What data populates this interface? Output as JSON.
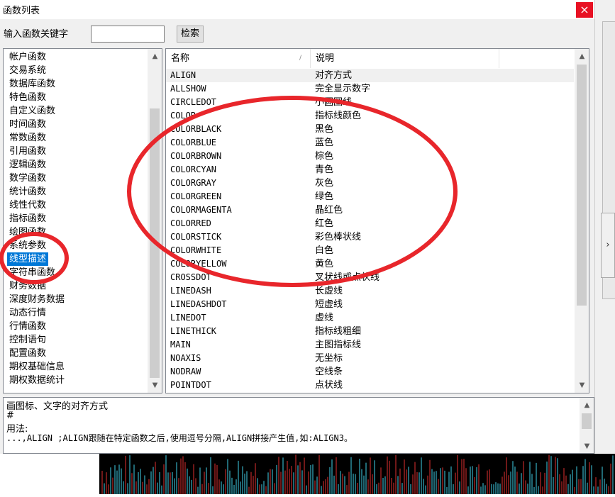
{
  "window": {
    "title": "函数列表",
    "close_label": "×"
  },
  "search": {
    "label": "输入函数关键字",
    "value": "",
    "button_label": "检索"
  },
  "categories": [
    "帐户函数",
    "交易系统",
    "数据库函数",
    "特色函数",
    "自定义函数",
    "时间函数",
    "常数函数",
    "引用函数",
    "逻辑函数",
    "数学函数",
    "统计函数",
    "线性代数",
    "指标函数",
    "绘图函数",
    "系统参数",
    "线型描述",
    "字符串函数",
    "财务数据",
    "深度财务数据",
    "动态行情",
    "行情函数",
    "控制语句",
    "配置函数",
    "期权基础信息",
    "期权数据统计"
  ],
  "selected_category": "线型描述",
  "columns": {
    "name": "名称",
    "desc": "说明"
  },
  "functions": [
    {
      "name": "ALIGN",
      "desc": "对齐方式"
    },
    {
      "name": "ALLSHOW",
      "desc": "完全显示数字"
    },
    {
      "name": "CIRCLEDOT",
      "desc": "小圆圈线"
    },
    {
      "name": "COLOR",
      "desc": "指标线颜色"
    },
    {
      "name": "COLORBLACK",
      "desc": "黑色"
    },
    {
      "name": "COLORBLUE",
      "desc": "蓝色"
    },
    {
      "name": "COLORBROWN",
      "desc": "棕色"
    },
    {
      "name": "COLORCYAN",
      "desc": "青色"
    },
    {
      "name": "COLORGRAY",
      "desc": "灰色"
    },
    {
      "name": "COLORGREEN",
      "desc": "绿色"
    },
    {
      "name": "COLORMAGENTA",
      "desc": "晶红色"
    },
    {
      "name": "COLORRED",
      "desc": "红色"
    },
    {
      "name": "COLORSTICK",
      "desc": "彩色棒状线"
    },
    {
      "name": "COLORWHITE",
      "desc": "白色"
    },
    {
      "name": "COLORYELLOW",
      "desc": "黄色"
    },
    {
      "name": "CROSSDOT",
      "desc": "叉状线或点状线"
    },
    {
      "name": "LINEDASH",
      "desc": "长虚线"
    },
    {
      "name": "LINEDASHDOT",
      "desc": "短虚线"
    },
    {
      "name": "LINEDOT",
      "desc": "虚线"
    },
    {
      "name": "LINETHICK",
      "desc": "指标线粗细"
    },
    {
      "name": "MAIN",
      "desc": "主图指标线"
    },
    {
      "name": "NOAXIS",
      "desc": "无坐标"
    },
    {
      "name": "NODRAW",
      "desc": "空线条"
    },
    {
      "name": "POINTDOT",
      "desc": "点状线"
    }
  ],
  "description": {
    "line1": "画图标、文字的对齐方式",
    "line2": "#",
    "line3": "用法:",
    "line4": "...,ALIGN ;ALIGN跟随在特定函数之后,使用逗号分隔,ALIGN拼接产生值,如:ALIGN3。"
  },
  "colors": {
    "annotation": "#e8262b",
    "selection": "#0078d7",
    "close": "#e81123"
  }
}
